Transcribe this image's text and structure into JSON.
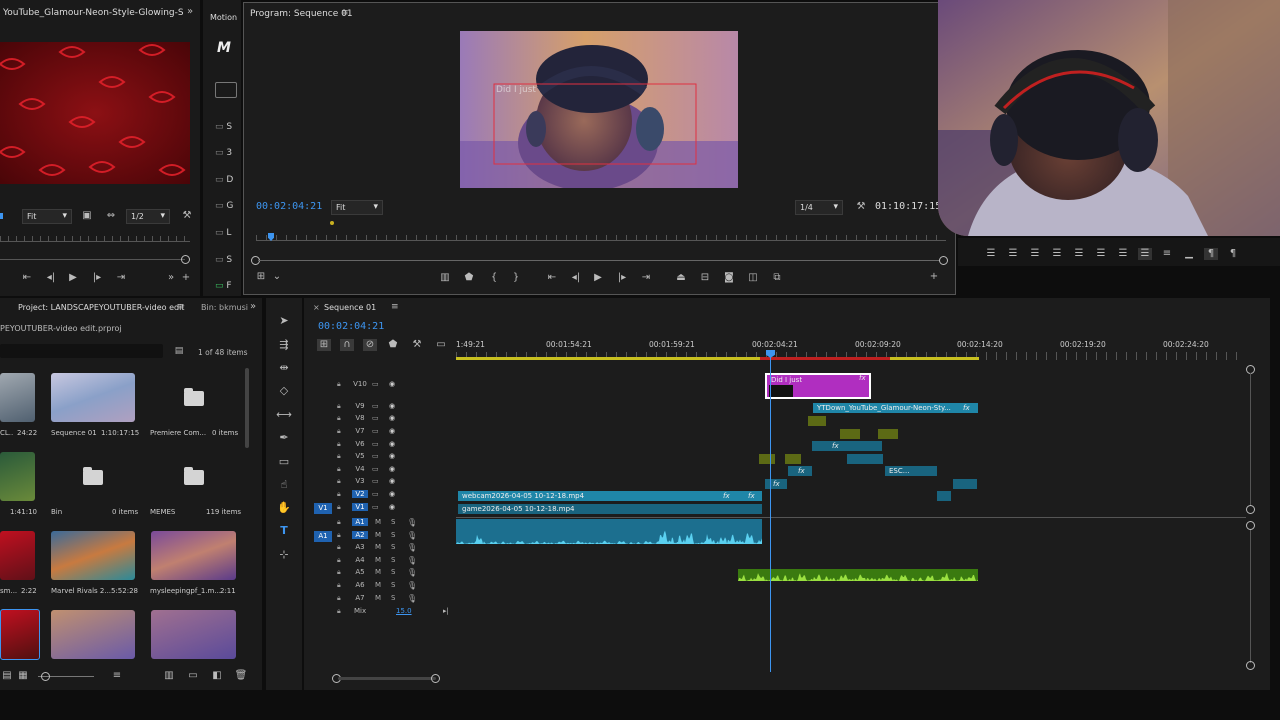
{
  "source_monitor": {
    "tab_title": "YouTube_Glamour-Neon-Style-Glowing-Sexy-Red",
    "fit": "Fit",
    "resolution": "1/2",
    "tab_motion": "Motion"
  },
  "program_monitor": {
    "tab_title": "Program: Sequence 01",
    "timecode": "00:02:04:21",
    "fit": "Fit",
    "resolution": "1/4",
    "duration": "01:10:17:15",
    "overlay_text": "Did I just"
  },
  "project": {
    "tab_title": "Project: LANDSCAPEYOUTUBER-video edit",
    "bin_tab": "Bin: bkmusi",
    "file_name": "PEYOUTUBER-video edit.prproj",
    "items_count": "1 of 48 items",
    "items": [
      {
        "name": "CL..",
        "meta": "24:22"
      },
      {
        "name": "Sequence 01",
        "meta": "1:10:17:15"
      },
      {
        "name": "Premiere Com...",
        "meta": "0 items"
      },
      {
        "name": "",
        "meta": "1:41:10"
      },
      {
        "name": "Bin",
        "meta": "0 items"
      },
      {
        "name": "MEMES",
        "meta": "119 items"
      },
      {
        "name": "sm...",
        "meta": "2:22"
      },
      {
        "name": "Marvel Rivals 2...",
        "meta": "5:52:28"
      },
      {
        "name": "mysleepingpf_1.m...",
        "meta": "2:11"
      }
    ]
  },
  "essential_sidebar": {
    "letters": [
      "S",
      "3",
      "D",
      "G",
      "L",
      "S",
      "F"
    ]
  },
  "timeline": {
    "tab_title": "Sequence 01",
    "timecode": "00:02:04:21",
    "ruler": [
      "1:49:21",
      "00:01:54:21",
      "00:01:59:21",
      "00:02:04:21",
      "00:02:09:20",
      "00:02:14:20",
      "00:02:19:20",
      "00:02:24:20"
    ],
    "video_tracks": [
      "V10",
      "V9",
      "V8",
      "V7",
      "V6",
      "V5",
      "V4",
      "V3",
      "V2",
      "V1"
    ],
    "audio_tracks": [
      "A1",
      "A2",
      "A3",
      "A4",
      "A5",
      "A6",
      "A7"
    ],
    "mix_label": "Mix",
    "mix_value": "15.0",
    "source_patch_v": "V1",
    "source_patch_a": "A1",
    "clips": {
      "title": "Did I just",
      "neon": "YTDown_YouTube_Glamour-Neon-Sty...",
      "esc": "ESC...",
      "webcam": "webcam2026-04-05 10-12-18.mp4",
      "game": "game2026-04-05 10-12-18.mp4",
      "fx": "fx"
    }
  }
}
